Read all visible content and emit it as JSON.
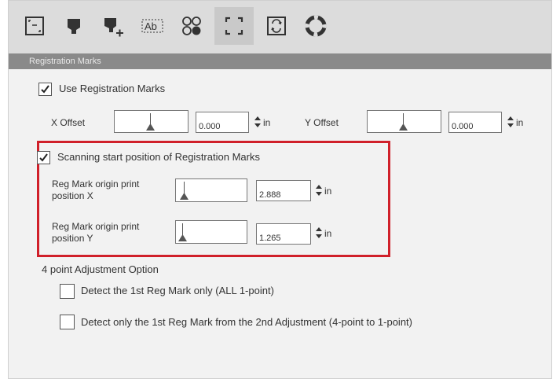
{
  "section": {
    "title": "Registration Marks"
  },
  "toolbar": {
    "icons": [
      "page-setup-icon",
      "pen-icon",
      "add-pen-icon",
      "text-ab-icon",
      "circles-icon",
      "registration-marks-icon",
      "auto-registration-icon",
      "help-lifebuoy-icon"
    ],
    "active_index": 5
  },
  "use_reg_marks": {
    "label": "Use Registration Marks",
    "checked": true
  },
  "x_offset": {
    "label": "X Offset",
    "value": "0.000",
    "unit": "in"
  },
  "y_offset": {
    "label": "Y Offset",
    "value": "0.000",
    "unit": "in"
  },
  "scan_start": {
    "label": "Scanning start position of Registration Marks",
    "checked": true
  },
  "origin_x": {
    "label_line1": "Reg Mark origin print",
    "label_line2": "position X",
    "value": "2.888",
    "unit": "in"
  },
  "origin_y": {
    "label_line1": "Reg Mark origin print",
    "label_line2": "position Y",
    "value": "1.265",
    "unit": "in"
  },
  "adjustment": {
    "title": "4 point Adjustment Option",
    "opt1": {
      "label": "Detect the 1st Reg Mark only (ALL 1-point)",
      "checked": false
    },
    "opt2": {
      "label": "Detect only the 1st Reg Mark from the 2nd Adjustment (4-point to 1-point)",
      "checked": false
    }
  },
  "colors": {
    "highlight": "#d0202a",
    "header_bg": "#8a8a8a"
  }
}
